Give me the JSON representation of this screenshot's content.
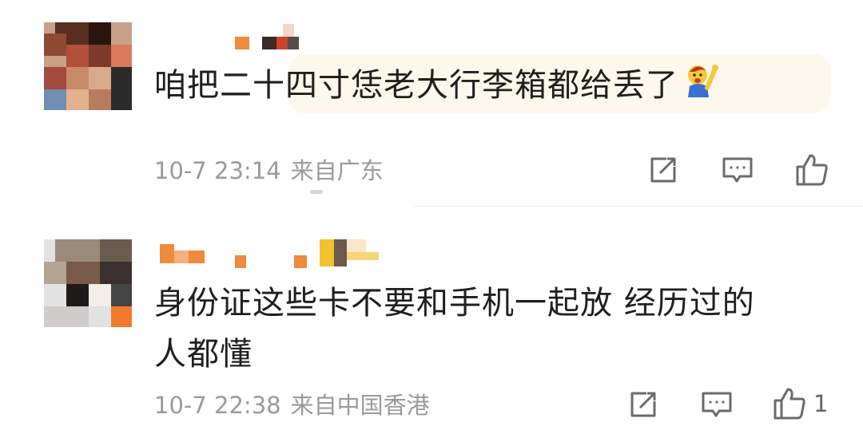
{
  "comments": [
    {
      "text_lines": [
        "咱把二十四寸恁老大行李箱都给丢了"
      ],
      "emoji": "person-raising-hand-emoji",
      "time": "10-7 23:14",
      "location": "来自广东",
      "likes": ""
    },
    {
      "text_lines": [
        "身份证这些卡不要和手机一起放 经历过的",
        "人都懂"
      ],
      "time": "10-7 22:38",
      "location": "来自中国香港",
      "likes": "1"
    }
  ],
  "icons": {
    "share": "share-icon",
    "reply": "comment-icon",
    "like": "thumbs-up-icon"
  },
  "colors": {
    "text": "#1f1f1f",
    "meta": "#9a9a9a",
    "icon": "#6b6b6b",
    "highlight": "#fdf8ec"
  }
}
